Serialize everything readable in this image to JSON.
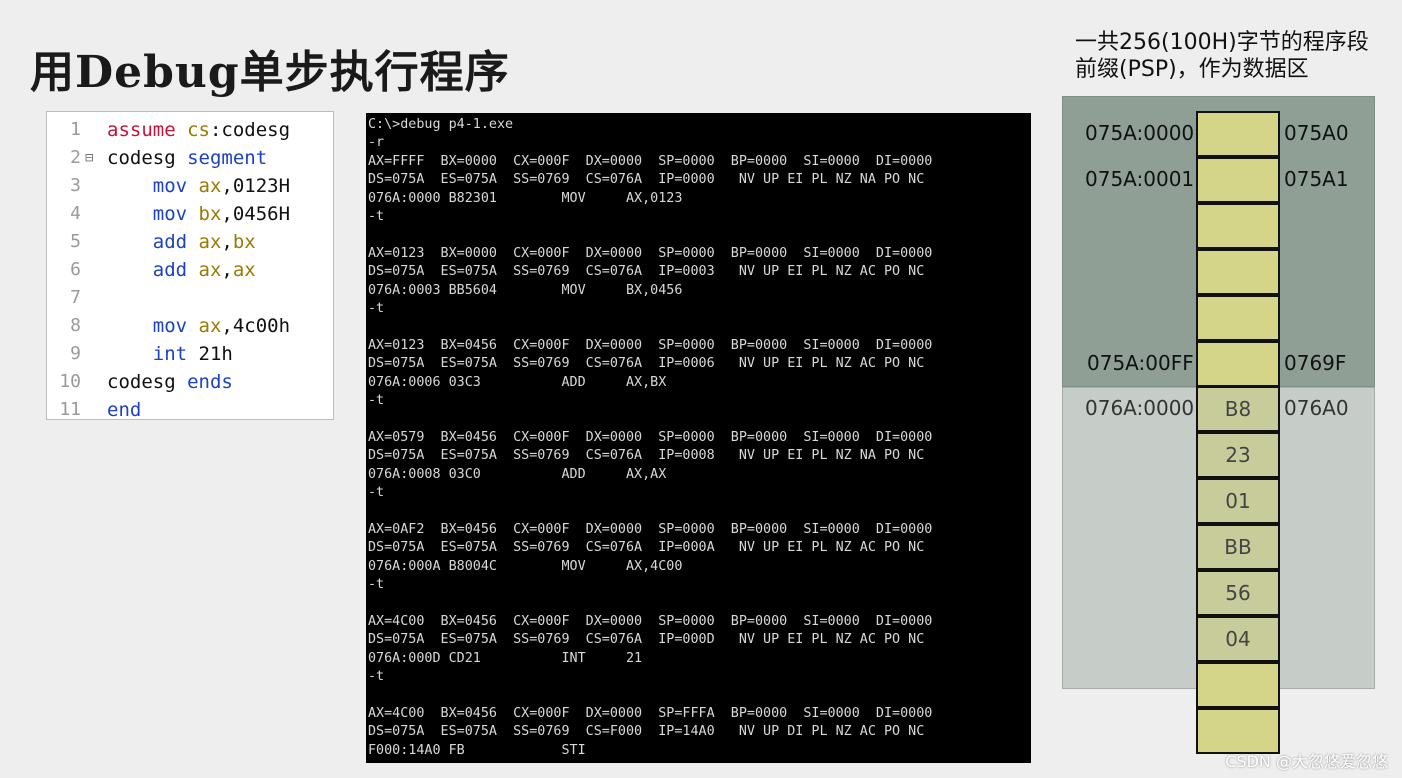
{
  "page": {
    "title": "用Debug单步执行程序"
  },
  "editor": {
    "lines": [
      {
        "num": "1",
        "parts": [
          {
            "t": "assume ",
            "c": "kw-red"
          },
          {
            "t": "cs",
            "c": "kw-gold"
          },
          {
            "t": ":codesg",
            "c": ""
          }
        ]
      },
      {
        "num": "2",
        "fold": "⊟",
        "parts": [
          {
            "t": "codesg ",
            "c": ""
          },
          {
            "t": "segment",
            "c": "kw-blue"
          }
        ]
      },
      {
        "num": "3",
        "parts": [
          {
            "t": "    mov ",
            "c": "kw-blue"
          },
          {
            "t": "ax",
            "c": "kw-gold"
          },
          {
            "t": ",0123H",
            "c": ""
          }
        ]
      },
      {
        "num": "4",
        "parts": [
          {
            "t": "    mov ",
            "c": "kw-blue"
          },
          {
            "t": "bx",
            "c": "kw-gold"
          },
          {
            "t": ",0456H",
            "c": ""
          }
        ]
      },
      {
        "num": "5",
        "parts": [
          {
            "t": "    add ",
            "c": "kw-blue"
          },
          {
            "t": "ax",
            "c": "kw-gold"
          },
          {
            "t": ",",
            "c": ""
          },
          {
            "t": "bx",
            "c": "kw-gold"
          }
        ]
      },
      {
        "num": "6",
        "parts": [
          {
            "t": "    add ",
            "c": "kw-blue"
          },
          {
            "t": "ax",
            "c": "kw-gold"
          },
          {
            "t": ",",
            "c": ""
          },
          {
            "t": "ax",
            "c": "kw-gold"
          }
        ]
      },
      {
        "num": "7",
        "parts": []
      },
      {
        "num": "8",
        "parts": [
          {
            "t": "    mov ",
            "c": "kw-blue"
          },
          {
            "t": "ax",
            "c": "kw-gold"
          },
          {
            "t": ",4c00h",
            "c": ""
          }
        ]
      },
      {
        "num": "9",
        "parts": [
          {
            "t": "    int ",
            "c": "kw-blue"
          },
          {
            "t": "21h",
            "c": ""
          }
        ]
      },
      {
        "num": "10",
        "parts": [
          {
            "t": "codesg ",
            "c": ""
          },
          {
            "t": "ends",
            "c": "kw-blue"
          }
        ]
      },
      {
        "num": "11",
        "parts": [
          {
            "t": "end",
            "c": "kw-blue"
          }
        ]
      }
    ]
  },
  "terminal": {
    "lines": [
      "C:\\>debug p4-1.exe",
      "-r",
      "AX=FFFF  BX=0000  CX=000F  DX=0000  SP=0000  BP=0000  SI=0000  DI=0000",
      "DS=075A  ES=075A  SS=0769  CS=076A  IP=0000   NV UP EI PL NZ NA PO NC",
      "076A:0000 B82301        MOV     AX,0123",
      "-t",
      "",
      "AX=0123  BX=0000  CX=000F  DX=0000  SP=0000  BP=0000  SI=0000  DI=0000",
      "DS=075A  ES=075A  SS=0769  CS=076A  IP=0003   NV UP EI PL NZ AC PO NC",
      "076A:0003 BB5604        MOV     BX,0456",
      "-t",
      "",
      "AX=0123  BX=0456  CX=000F  DX=0000  SP=0000  BP=0000  SI=0000  DI=0000",
      "DS=075A  ES=075A  SS=0769  CS=076A  IP=0006   NV UP EI PL NZ AC PO NC",
      "076A:0006 03C3          ADD     AX,BX",
      "-t",
      "",
      "AX=0579  BX=0456  CX=000F  DX=0000  SP=0000  BP=0000  SI=0000  DI=0000",
      "DS=075A  ES=075A  SS=0769  CS=076A  IP=0008   NV UP EI PL NZ NA PO NC",
      "076A:0008 03C0          ADD     AX,AX",
      "-t",
      "",
      "AX=0AF2  BX=0456  CX=000F  DX=0000  SP=0000  BP=0000  SI=0000  DI=0000",
      "DS=075A  ES=075A  SS=0769  CS=076A  IP=000A   NV UP EI PL NZ AC PO NC",
      "076A:000A B8004C        MOV     AX,4C00",
      "-t",
      "",
      "AX=4C00  BX=0456  CX=000F  DX=0000  SP=0000  BP=0000  SI=0000  DI=0000",
      "DS=075A  ES=075A  SS=0769  CS=076A  IP=000D   NV UP EI PL NZ AC PO NC",
      "076A:000D CD21          INT     21",
      "-t",
      "",
      "AX=4C00  BX=0456  CX=000F  DX=0000  SP=FFFA  BP=0000  SI=0000  DI=0000",
      "DS=075A  ES=075A  SS=0769  CS=F000  IP=14A0   NV UP DI PL NZ AC PO NC",
      "F000:14A0 FB            STI"
    ]
  },
  "memory": {
    "caption_line1": "一共256(100H)字节的程序段",
    "caption_line2": "前缀(PSP)，作为数据区",
    "psp_rows": [
      {
        "left": "075A:0000",
        "value": "",
        "right": "075A0"
      },
      {
        "left": "075A:0001",
        "value": "",
        "right": "075A1"
      },
      {
        "left": "",
        "value": "",
        "right": ""
      },
      {
        "left": "",
        "value": "",
        "right": ""
      },
      {
        "left": "",
        "value": "",
        "right": ""
      },
      {
        "left": "075A:00FF",
        "value": "",
        "right": "0769F"
      }
    ],
    "prog_rows": [
      {
        "left": "076A:0000",
        "value": "B8",
        "right": "076A0"
      },
      {
        "left": "",
        "value": "23",
        "right": ""
      },
      {
        "left": "",
        "value": "01",
        "right": ""
      },
      {
        "left": "",
        "value": "BB",
        "right": ""
      },
      {
        "left": "",
        "value": "56",
        "right": ""
      },
      {
        "left": "",
        "value": "04",
        "right": ""
      },
      {
        "left": "",
        "value": "",
        "right": ""
      },
      {
        "left": "",
        "value": "",
        "right": ""
      }
    ]
  },
  "watermark": "CSDN @大忽悠爱忽悠"
}
